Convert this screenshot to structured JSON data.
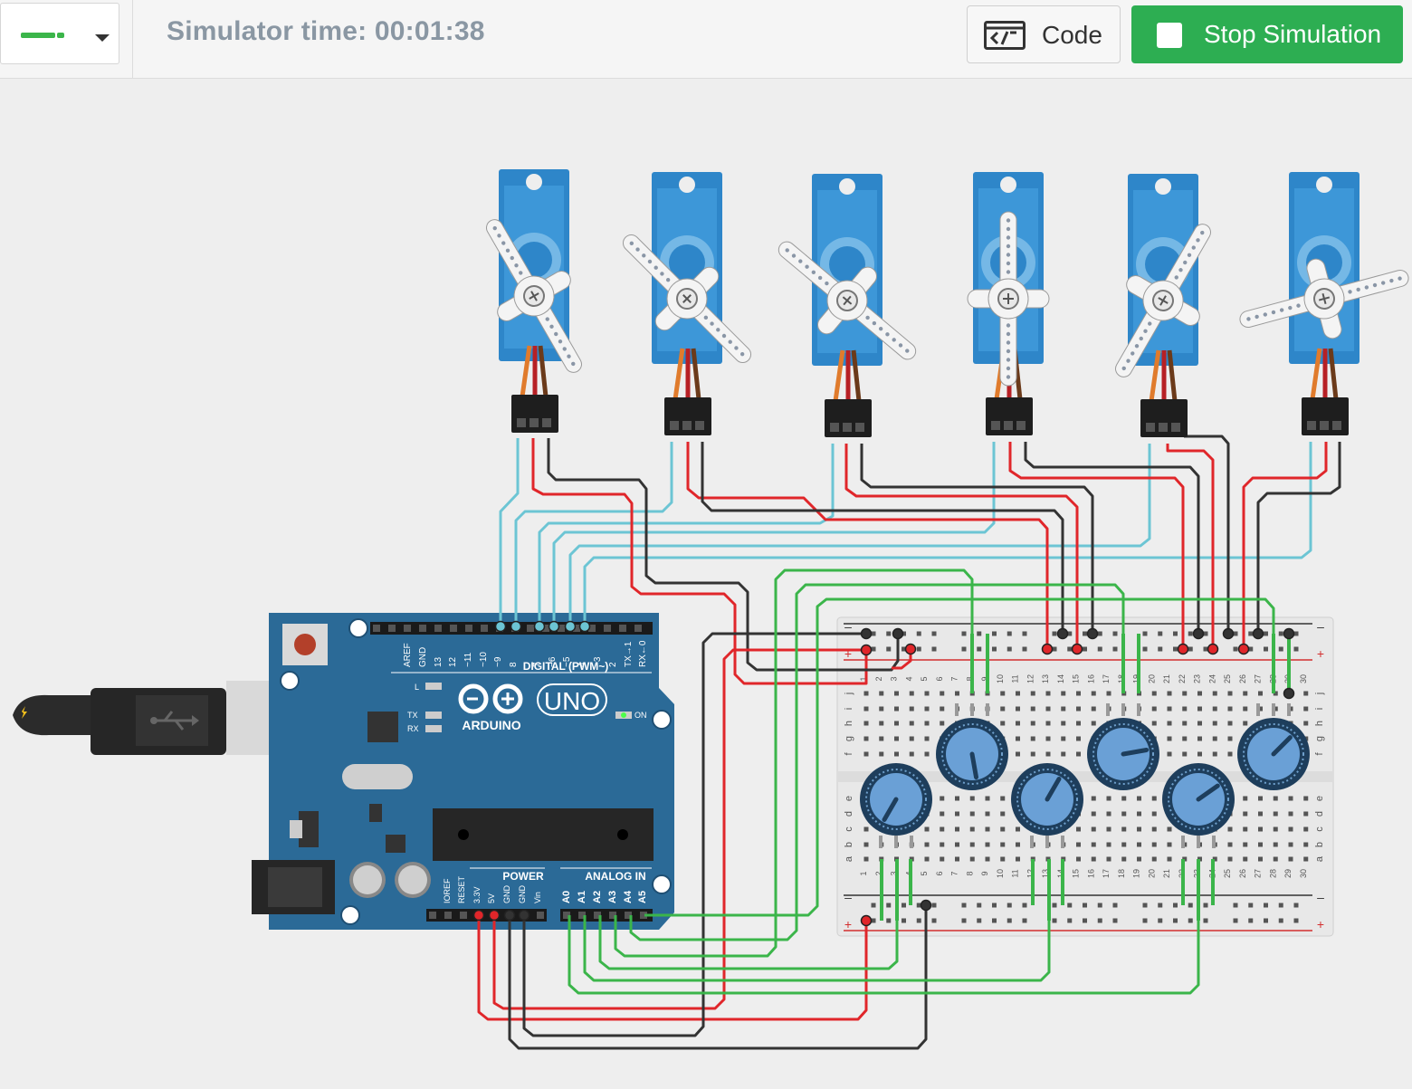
{
  "toolbar": {
    "simulator_time": "Simulator time: 00:01:38",
    "code_label": "Code",
    "stop_label": "Stop Simulation",
    "wire_color": "#3bb54a"
  },
  "icons": {
    "code": "code-editor-icon",
    "stop": "stop-square-icon",
    "dropdown": "chevron-down-icon",
    "usb": "usb-icon"
  },
  "arduino": {
    "brand": "ARDUINO",
    "model": "UNO",
    "digital_label": "DIGITAL (PWM~)",
    "power_label": "POWER",
    "analog_label": "ANALOG IN",
    "on_label": "ON",
    "l_label": "L",
    "tx_label": "TX",
    "rx_label": "RX",
    "digital_pins": [
      "AREF",
      "GND",
      "13",
      "12",
      "~11",
      "~10",
      "~9",
      "8",
      "7",
      "~6",
      "~5",
      "4",
      "~3",
      "2",
      "TX→1",
      "RX←0"
    ],
    "power_pins": [
      "IOREF",
      "RESET",
      "3.3V",
      "5V",
      "GND",
      "GND",
      "Vin"
    ],
    "analog_pins": [
      "A0",
      "A1",
      "A2",
      "A3",
      "A4",
      "A5"
    ]
  },
  "breadboard": {
    "columns": [
      "1",
      "2",
      "3",
      "4",
      "5",
      "6",
      "7",
      "8",
      "9",
      "10",
      "11",
      "12",
      "13",
      "14",
      "15",
      "16",
      "17",
      "18",
      "19",
      "20",
      "21",
      "22",
      "23",
      "24",
      "25",
      "26",
      "27",
      "28",
      "29",
      "30"
    ],
    "rows_top": [
      "j",
      "i",
      "h",
      "g",
      "f"
    ],
    "rows_bottom": [
      "e",
      "d",
      "c",
      "b",
      "a"
    ],
    "plus": "+",
    "minus": "–"
  },
  "components": {
    "servo_count": 6,
    "potentiometer_count": 6
  },
  "colors": {
    "arduino_blue": "#2b6a97",
    "servo_blue": "#2e86c9",
    "signal_wire": "#6cc5d4",
    "power_wire": "#e0262a",
    "ground_wire": "#333333",
    "analog_wire": "#3bb54a",
    "stop_green": "#2dae52"
  }
}
